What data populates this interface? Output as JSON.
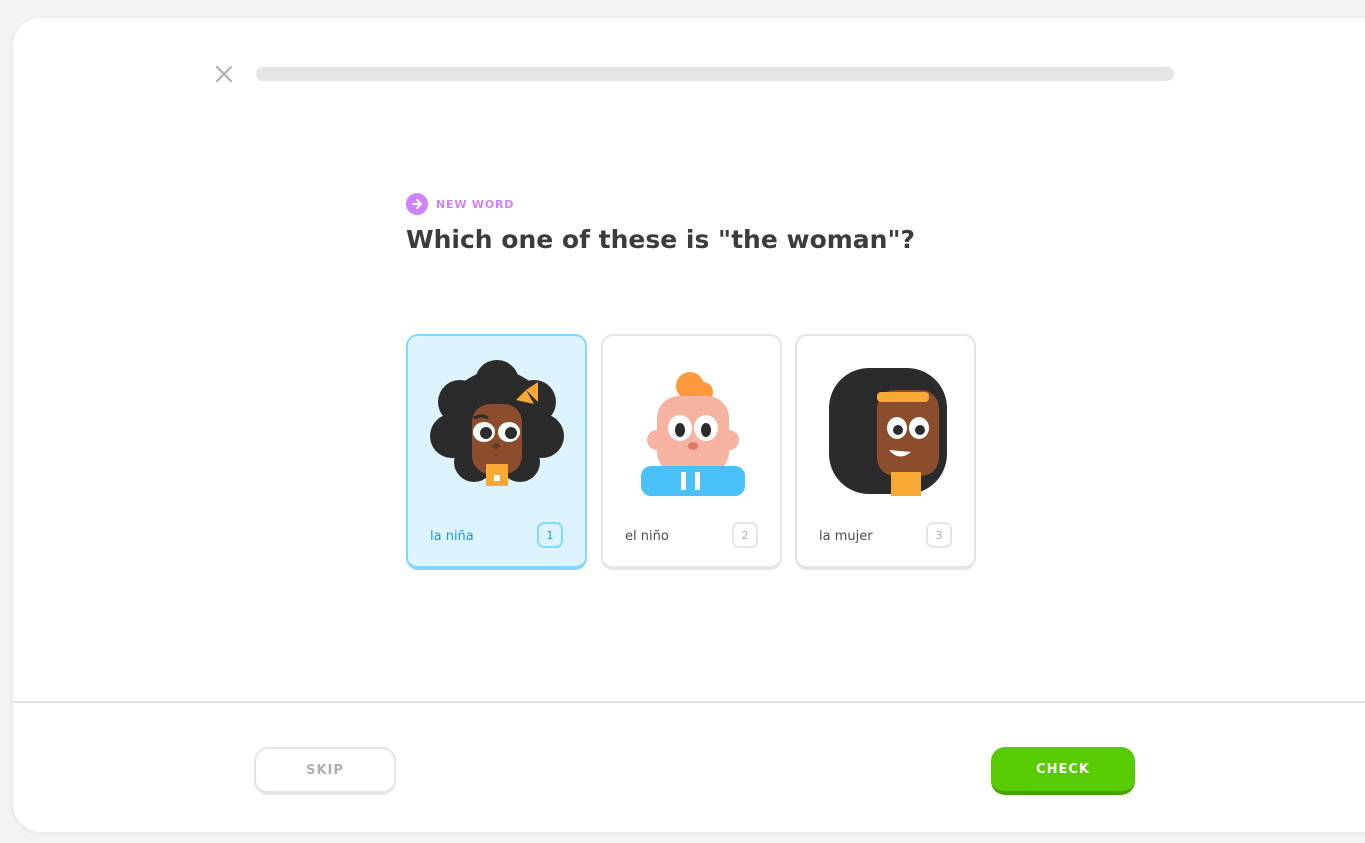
{
  "header": {
    "close_icon": "close-icon",
    "progress": 0
  },
  "challenge": {
    "badge_icon": "new-word-icon",
    "badge_label": "NEW WORD",
    "question": "Which one of these is \"the woman\"?"
  },
  "choices": [
    {
      "label": "la niña",
      "key": "1",
      "selected": true,
      "icon": "girl-character-icon"
    },
    {
      "label": "el niño",
      "key": "2",
      "selected": false,
      "icon": "boy-character-icon"
    },
    {
      "label": "la mujer",
      "key": "3",
      "selected": false,
      "icon": "woman-character-icon"
    }
  ],
  "footer": {
    "skip_label": "SKIP",
    "check_label": "CHECK"
  },
  "colors": {
    "accent_green": "#58cc02",
    "selected_blue": "#1899d6",
    "selected_bg": "#ddf4ff",
    "badge_purple": "#ce82ff"
  }
}
